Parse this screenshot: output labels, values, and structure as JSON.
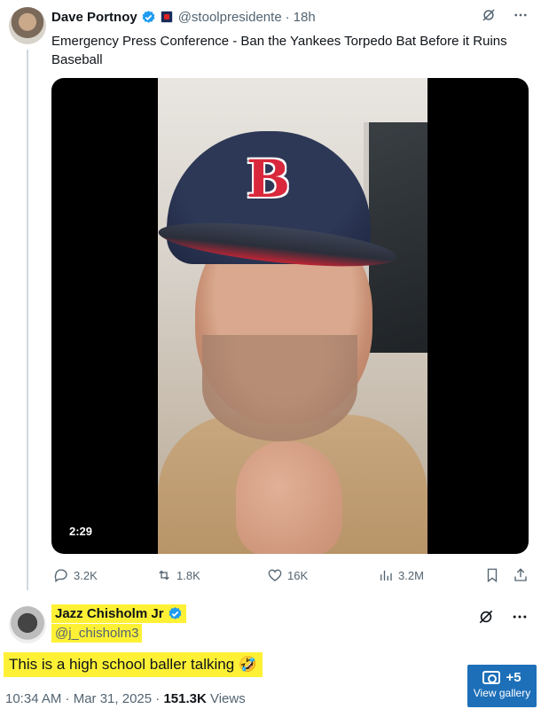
{
  "tweet": {
    "author_name": "Dave Portnoy",
    "handle": "@stoolpresidente",
    "separator": "·",
    "time": "18h",
    "text": "Emergency Press Conference - Ban the Yankees Torpedo Bat Before it Ruins Baseball",
    "video_duration": "2:29",
    "cap_letter": "B",
    "stats": {
      "replies": "3.2K",
      "reposts": "1.8K",
      "likes": "16K",
      "views": "3.2M"
    }
  },
  "reply": {
    "author_name": "Jazz Chisholm Jr",
    "handle": "@j_chisholm3",
    "text": "This is a high school baller talking 🤣",
    "footer_time": "10:34 AM · Mar 31, 2025 · ",
    "footer_views_count": "151.3K",
    "footer_views_label": " Views"
  },
  "gallery": {
    "count": "+5",
    "label": "View gallery"
  },
  "icons": {
    "more": "more-horizontal-icon",
    "grok": "grok-icon",
    "reply": "reply-icon",
    "repost": "repost-icon",
    "like": "heart-icon",
    "views": "views-bar-icon",
    "bookmark": "bookmark-icon",
    "share": "share-icon",
    "verified": "verified-badge-icon"
  },
  "colors": {
    "verified_blue": "#1d9bf0",
    "verified_gold": "#e2b719",
    "highlight": "#fef135",
    "gallery_blue": "#1d6fb8"
  }
}
